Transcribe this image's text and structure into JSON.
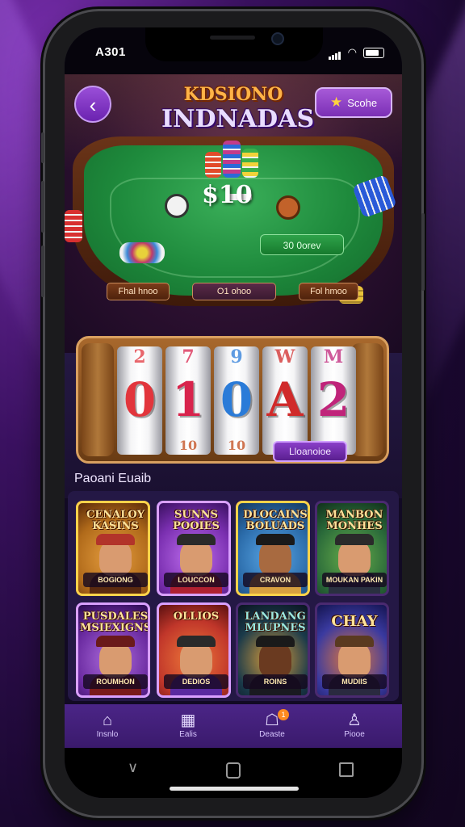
{
  "status_bar": {
    "time": "A301"
  },
  "header": {
    "title_line1": "KDSIONO",
    "title_line2": "INDNADAS",
    "back_icon": "chevron-left-icon",
    "top_button_label": "Scohe",
    "top_button_icon": "star-icon"
  },
  "poker_table": {
    "pot": "$10",
    "bet_label": "30 0orev",
    "seats": [
      "Fhal hnoo",
      "O1 ohoo",
      "Fol hmoo"
    ]
  },
  "slot_machine": {
    "reels": [
      {
        "top": "2",
        "mid": "0",
        "bot": "",
        "color": "#e2353c"
      },
      {
        "top": "7",
        "mid": "1",
        "bot": "10",
        "color": "#d8234c"
      },
      {
        "top": "9",
        "mid": "0",
        "bot": "10",
        "color": "#2a7bd8"
      },
      {
        "top": "W",
        "mid": "A",
        "bot": "",
        "color": "#d02a2a"
      },
      {
        "top": "M",
        "mid": "2",
        "bot": "",
        "color": "#c0247a"
      }
    ],
    "button_label": "Lloanoioe"
  },
  "games_section": {
    "title": "Paoani Euaib",
    "games": [
      {
        "title": "CENALOY KASINS",
        "label": "BOGIONG",
        "bg": "#b06a1a",
        "border": "#ffd24a",
        "hat": "#b2342a",
        "body": "#5a2a10"
      },
      {
        "title": "SUNNS POOIES",
        "label": "LOUCCON",
        "bg": "#7a2fb0",
        "border": "#d9a0ff",
        "hat": "#2a2a2a",
        "body": "#b02030"
      },
      {
        "title": "DLOCAINS BOLUADS",
        "label": "CRAVON",
        "bg": "#2a6aa8",
        "border": "#ffd24a",
        "hat": "#1a1a1a",
        "body": "#d8a040"
      },
      {
        "title": "MANBON MONHES",
        "label": "MOUKAN PAKIN",
        "bg": "#2a6a3a",
        "border": "#4a2a70",
        "hat": "#2a2a2a",
        "body": "#2a3040"
      },
      {
        "title": "PUSDALES MSIEXIGNS",
        "label": "ROUMHON",
        "bg": "#6a2aa0",
        "border": "#d9a0ff",
        "hat": "#6a1a1a",
        "body": "#7a1a1a"
      },
      {
        "title": "OLLIOS",
        "label": "DEDIOS",
        "bg": "#c0362a",
        "border": "#d9a0ff",
        "hat": "#2a2a2a",
        "body": "#5a2aa0"
      },
      {
        "title": "LANDANG MLUPNES",
        "label": "ROINS",
        "bg": "#1a3a4a",
        "border": "#4a2a70",
        "hat": "#1a1a1a",
        "body": "#1a1a20"
      },
      {
        "title": "CHAY",
        "label": "MUDIIS",
        "bg": "#3a3aa0",
        "border": "#4a2a70",
        "hat": "#5a3a20",
        "body": "#2a2a40"
      }
    ]
  },
  "bottom_nav": {
    "items": [
      {
        "label": "Insnlo",
        "icon": "home-icon"
      },
      {
        "label": "Ealis",
        "icon": "cards-icon"
      },
      {
        "label": "Deaste",
        "icon": "chat-icon",
        "badge": "1"
      },
      {
        "label": "Piooe",
        "icon": "profile-icon"
      }
    ]
  },
  "system_nav": {
    "back_icon": "back-icon",
    "home_icon": "home-button-icon",
    "recents_icon": "recents-icon"
  }
}
